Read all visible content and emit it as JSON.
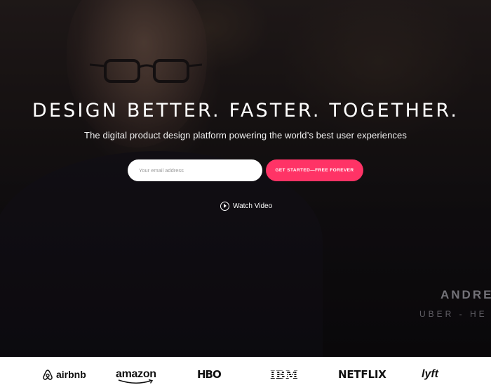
{
  "hero": {
    "headline": "DESIGN BETTER. FASTER. TOGETHER.",
    "subtitle": "The digital product design platform powering the world’s best user experiences",
    "email_placeholder": "Your email address",
    "cta_label": "GET STARTED—FREE FOREVER",
    "watch_video_label": "Watch Video",
    "speaker_name": "ANDRE",
    "speaker_title": "UBER - HE"
  },
  "logos": [
    {
      "name": "airbnb",
      "text": "airbnb"
    },
    {
      "name": "amazon",
      "text": "amazon"
    },
    {
      "name": "hbo",
      "text": "HBO"
    },
    {
      "name": "ibm",
      "text": "IBM"
    },
    {
      "name": "netflix",
      "text": "NETFLIX"
    },
    {
      "name": "lyft",
      "text": "lyft"
    }
  ],
  "colors": {
    "cta": "#ff3366",
    "logo_bar": "#ffffff",
    "hero_bg": "#0c0b0d"
  }
}
